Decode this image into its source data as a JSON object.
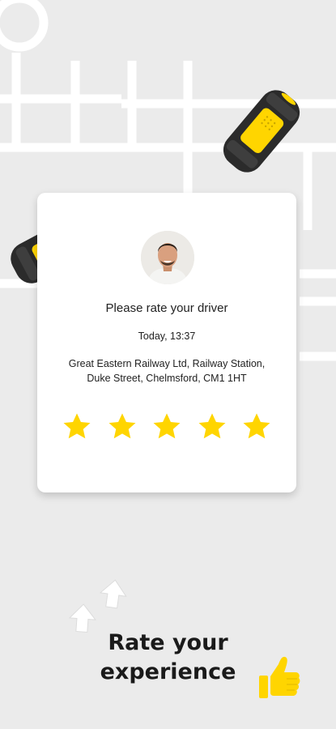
{
  "card": {
    "title": "Please rate your driver",
    "time": "Today, 13:37",
    "address_line1": "Great Eastern Railway Ltd, Railway Station,",
    "address_line2": "Duke Street, Chelmsford, CM1 1HT",
    "rating_max": 5,
    "rating_value": 5
  },
  "headline": {
    "line1": "Rate your",
    "line2": "experience"
  },
  "colors": {
    "background": "#ebebeb",
    "road": "#ffffff",
    "accent": "#ffd500",
    "car_body": "#2b2b2b",
    "text": "#1a1a1a"
  },
  "icons": [
    "taxi-icon",
    "star-icon",
    "arrow-up-icon",
    "thumbs-up-icon"
  ]
}
